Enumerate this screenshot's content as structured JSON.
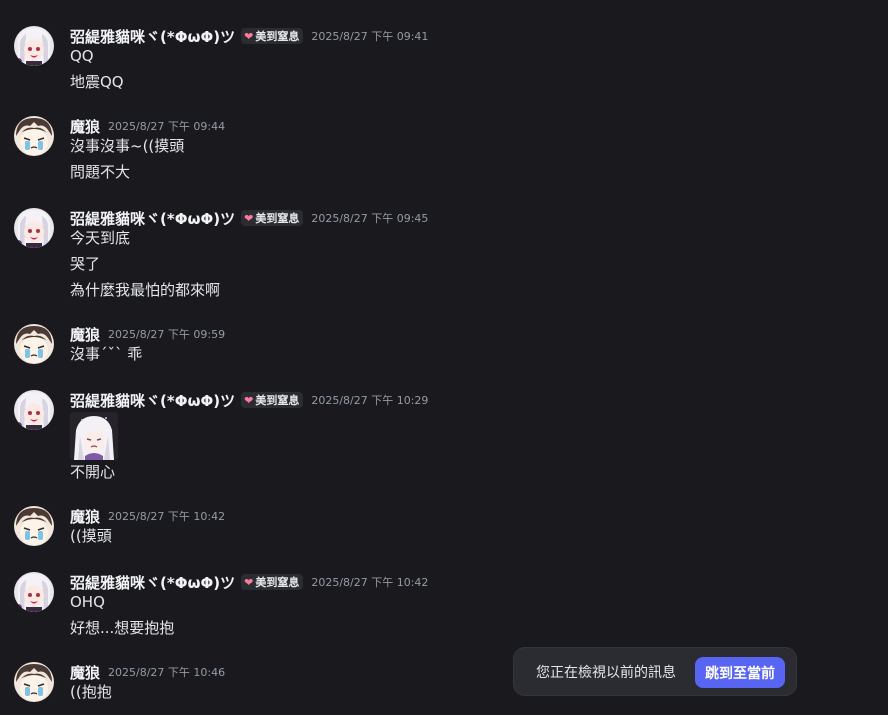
{
  "colors": {
    "background": "#1a1a1e",
    "username": "#f2f3f5",
    "timestamp": "#949ba4",
    "tag_background": "#2b2c31",
    "tag_heart": "#ff7a9c",
    "jump_button": "#5865f2"
  },
  "users": {
    "cat": {
      "name": "弨緹雅貓咪ヾ(*ΦωΦ)ツ",
      "tag": "美到窒息",
      "tag_icon": "heart-icon",
      "avatar_icon": "white-hair-girl-avatar"
    },
    "wolf": {
      "name": "魔狼",
      "avatar_icon": "crying-boy-avatar"
    }
  },
  "messages": [
    {
      "user": "cat",
      "timestamp": "2025/8/27 下午 09:41",
      "lines": [
        "QQ",
        "地震QQ"
      ]
    },
    {
      "user": "wolf",
      "timestamp": "2025/8/27 下午 09:44",
      "lines": [
        "沒事沒事~((摸頭",
        "問題不大"
      ]
    },
    {
      "user": "cat",
      "timestamp": "2025/8/27 下午 09:45",
      "lines": [
        "今天到底",
        "哭了",
        "為什麼我最怕的都來啊"
      ]
    },
    {
      "user": "wolf",
      "timestamp": "2025/8/27 下午 09:59",
      "lines": [
        "沒事ˊˇˋ 乖"
      ]
    },
    {
      "user": "cat",
      "timestamp": "2025/8/27 下午 10:29",
      "sticker": "sad-girl-sticker",
      "lines": [
        "不開心"
      ]
    },
    {
      "user": "wolf",
      "timestamp": "2025/8/27 下午 10:42",
      "lines": [
        "((摸頭"
      ]
    },
    {
      "user": "cat",
      "timestamp": "2025/8/27 下午 10:42",
      "lines": [
        "OHQ",
        "好想...想要抱抱"
      ]
    },
    {
      "user": "wolf",
      "timestamp": "2025/8/27 下午 10:46",
      "lines": [
        "((抱抱"
      ]
    }
  ],
  "jump_bar": {
    "text": "您正在檢視以前的訊息",
    "button_label": "跳到至當前"
  }
}
